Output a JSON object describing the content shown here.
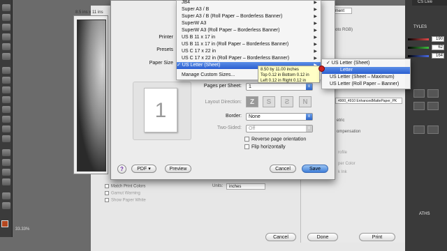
{
  "app": {
    "right_top_label": "CS Live",
    "zoom": "33.33%",
    "panel_tab": "TYLES",
    "paths_tab": "ATHS"
  },
  "sliders": [
    {
      "color": "#e24a4a",
      "value": "190"
    },
    {
      "color": "#3fbf3f",
      "value": "62"
    },
    {
      "color": "#4a6ae2",
      "value": "164"
    }
  ],
  "print_bg": {
    "preview_size": "8.5 ins x 11 ins",
    "color_management": "Management",
    "profile_fragment": "oto RGB)",
    "paper_fragment": "4900_4910 EnhancedMattePaper_PK",
    "metric_fragment": "etric",
    "compensation": "ompensation",
    "rofile": "rofile",
    "per_color": "per Color",
    "ink": "k Ink",
    "match_print_colors": "Match Print Colors",
    "gamut_warning": "Gamut Warning",
    "show_paper_white": "Show Paper White",
    "units_label": "Units:",
    "units_value": "inches",
    "cancel": "Cancel",
    "done": "Done",
    "print": "Print"
  },
  "sheet": {
    "printer_label": "Printer",
    "presets_label": "Presets",
    "paper_size_label": "Paper Size",
    "paper_size_value": "✓ US Letter (Sheet)",
    "pages_per_sheet_label": "Pages per Sheet:",
    "pages_per_sheet_value": "1",
    "layout_direction_label": "Layout Direction:",
    "border_label": "Border:",
    "border_value": "None",
    "two_sided_label": "Two-Sided:",
    "two_sided_value": "Off",
    "reverse_orientation": "Reverse page orientation",
    "flip_horizontally": "Flip horizontally",
    "page_number": "1",
    "help": "?",
    "pdf": "PDF ▾",
    "preview": "Preview",
    "cancel": "Cancel",
    "save": "Save"
  },
  "menu1": {
    "items": [
      {
        "label": "JB4",
        "sub": "▶"
      },
      {
        "label": "Super A3 / B",
        "sub": "▶"
      },
      {
        "label": "Super A3 / B (Roll Paper – Borderless Banner)",
        "sub": "▶"
      },
      {
        "label": "SuperW A3",
        "sub": "▶"
      },
      {
        "label": "SuperW A3 (Roll Paper – Borderless Banner)",
        "sub": "▶"
      },
      {
        "label": "US B 11 x 17 in",
        "sub": "▶"
      },
      {
        "label": "US B 11 x 17 in (Roll Paper – Borderless Banner)",
        "sub": "▶"
      },
      {
        "label": "US C 17 x 22 in",
        "sub": "▶"
      },
      {
        "label": "US C 17 x 22 in (Roll Paper – Borderless Banner)",
        "sub": "▶"
      },
      {
        "label": "✓ US Letter (Sheet)",
        "sub": "▶"
      }
    ],
    "custom": "Manage Custom Sizes..."
  },
  "tooltip": {
    "line1": "8.50 by 11.00 inches",
    "line2": "Top 0.12 in Bottom 0.12 in",
    "line3": "Left 0.12 in Right 0.12 in"
  },
  "menu2": {
    "items": [
      "✓ US Letter (Sheet)",
      "Letter",
      "US Letter (Sheet – Maximum)",
      "US Letter (Roll Paper – Banner)"
    ]
  }
}
